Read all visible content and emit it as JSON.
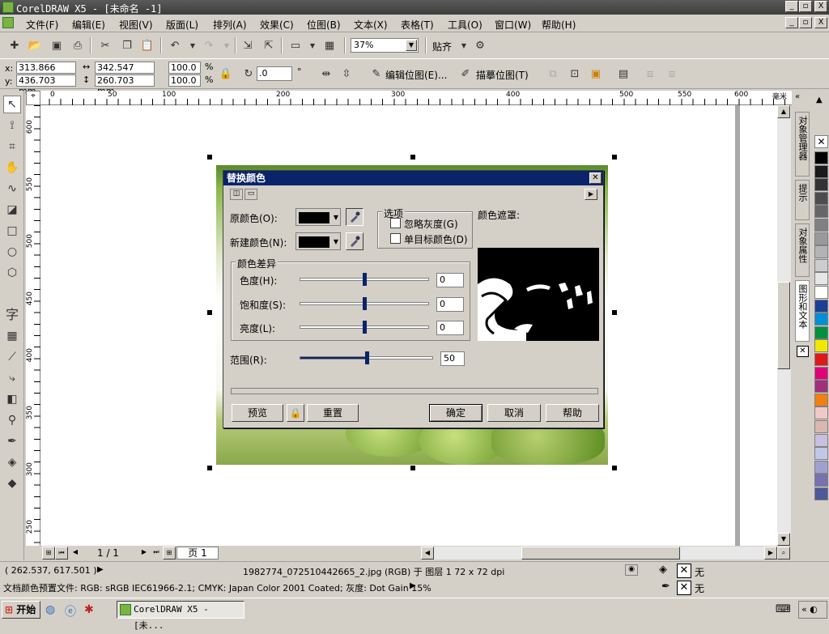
{
  "window": {
    "title": "CorelDRAW X5 - [未命名 -1]",
    "minimize": "_",
    "maximize": "▫",
    "close": "X"
  },
  "menu": [
    "文件(F)",
    "编辑(E)",
    "视图(V)",
    "版面(L)",
    "排列(A)",
    "效果(C)",
    "位图(B)",
    "文本(X)",
    "表格(T)",
    "工具(O)",
    "窗口(W)",
    "帮助(H)"
  ],
  "standard_toolbar": {
    "zoom": "37%",
    "snap_label": "贴齐"
  },
  "property_bar": {
    "x_label": "x:",
    "x_value": "313.866 mm",
    "y_label": "y:",
    "y_value": "436.703 mm",
    "width_value": "342.547 mm",
    "height_value": "260.703 mm",
    "scale_w": "100.0",
    "scale_h": "100.0",
    "percent": "%",
    "rotation": ".0",
    "degree": "°",
    "edit_bitmap": "编辑位图(E)...",
    "trace_bitmap": "描摹位图(T)"
  },
  "ruler": {
    "h_labels": [
      "0",
      "50",
      "100",
      "150",
      "200",
      "250",
      "300",
      "350",
      "400",
      "450",
      "500",
      "550",
      "600"
    ],
    "unit": "毫米",
    "v_labels": [
      "600",
      "550",
      "500",
      "450",
      "400",
      "350",
      "300",
      "250"
    ]
  },
  "dockers": [
    "对象管理器",
    "提示",
    "对象属性",
    "图形和文本"
  ],
  "palette": [
    "#ffffff",
    "#000000",
    "#1a1a1a",
    "#333333",
    "#4d4d4d",
    "#666666",
    "#808080",
    "#999999",
    "#b3b3b3",
    "#cccccc",
    "#e6e6e6",
    "#ffffff",
    "#1c3f94",
    "#0090d8",
    "#009040",
    "#f0e800",
    "#e01818",
    "#e0007a",
    "#a0307a",
    "#f08010",
    "#f0c8c8",
    "#d8b8b0",
    "#c8c0e0",
    "#c0c8e8",
    "#a0a0d0",
    "#7870b0",
    "#4c5898"
  ],
  "dialog": {
    "title": "替换颜色",
    "original_color_label": "原颜色(O):",
    "new_color_label": "新建颜色(N):",
    "options_group": "选项",
    "ignore_gray": "忽略灰度(G)",
    "single_target": "单目标颜色(D)",
    "mask_label": "颜色遮罩:",
    "diff_group": "颜色差异",
    "hue_label": "色度(H):",
    "hue_value": "0",
    "saturation_label": "饱和度(S):",
    "saturation_value": "0",
    "brightness_label": "亮度(L):",
    "brightness_value": "0",
    "range_label": "范围(R):",
    "range_value": "50",
    "preview_button": "预览",
    "reset_button": "重置",
    "ok_button": "确定",
    "cancel_button": "取消",
    "help_button": "帮助"
  },
  "page_nav": {
    "page_counter": "1 / 1",
    "page_tab": "页 1"
  },
  "status": {
    "coords": "( 262.537, 617.501 )",
    "object_info": "1982774_072510442665_2.jpg (RGB) 于 图层 1 72 x 72 dpi",
    "color_profile": "文档颜色预置文件: RGB: sRGB IEC61966-2.1; CMYK: Japan Color 2001 Coated; 灰度: Dot Gain 15%",
    "fill_none": "无",
    "outline_none": "无"
  },
  "taskbar": {
    "start": "开始",
    "app_button": "CorelDRAW X5 - [未..."
  }
}
